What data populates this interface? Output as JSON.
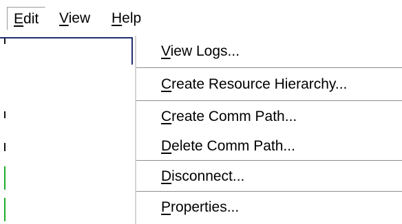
{
  "menubar": {
    "items": [
      {
        "label_rest": "dit",
        "mnemonic": "E"
      },
      {
        "label_rest": "iew",
        "mnemonic": "V"
      },
      {
        "label_rest": "elp",
        "mnemonic": "H"
      }
    ]
  },
  "dropdown": {
    "items": [
      {
        "mnemonic": "V",
        "rest": "iew Logs..."
      },
      {
        "mnemonic": "C",
        "rest": "reate Resource Hierarchy..."
      },
      {
        "mnemonic": "C",
        "rest": "reate Comm Path..."
      },
      {
        "mnemonic": "D",
        "rest": "elete Comm Path..."
      },
      {
        "mnemonic": "D",
        "rest": "isconnect..."
      },
      {
        "mnemonic": "P",
        "rest": "roperties..."
      }
    ]
  },
  "colors": {
    "background": "#ffffff",
    "selection_edge": "#1f2b6e",
    "status_green": "#1faa2a"
  }
}
